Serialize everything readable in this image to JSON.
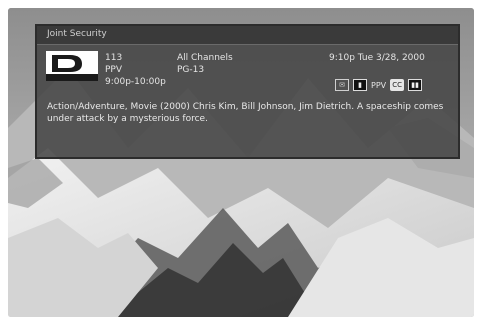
{
  "banner": {
    "title": "Joint Security",
    "channel_number": "113",
    "channel_type": "PPV",
    "time_range": "9:00p-10:00p",
    "category": "All Channels",
    "rating": "PG-13",
    "datetime": "9:10p Tue 3/28, 2000",
    "description": "Action/Adventure, Movie (2000) Chris Kim, Bill Johnson, Jim Dietrich. A spaceship comes under attack by a mysterious force.",
    "logo_text": "DIRECTV",
    "icons": [
      {
        "name": "mail-icon",
        "label": "✉"
      },
      {
        "name": "lock-icon",
        "label": "▮"
      },
      {
        "name": "ppv-icon",
        "label": "PPV"
      },
      {
        "name": "cc-icon",
        "label": "CC"
      },
      {
        "name": "dual-screen-icon",
        "label": "▮▮"
      }
    ]
  }
}
